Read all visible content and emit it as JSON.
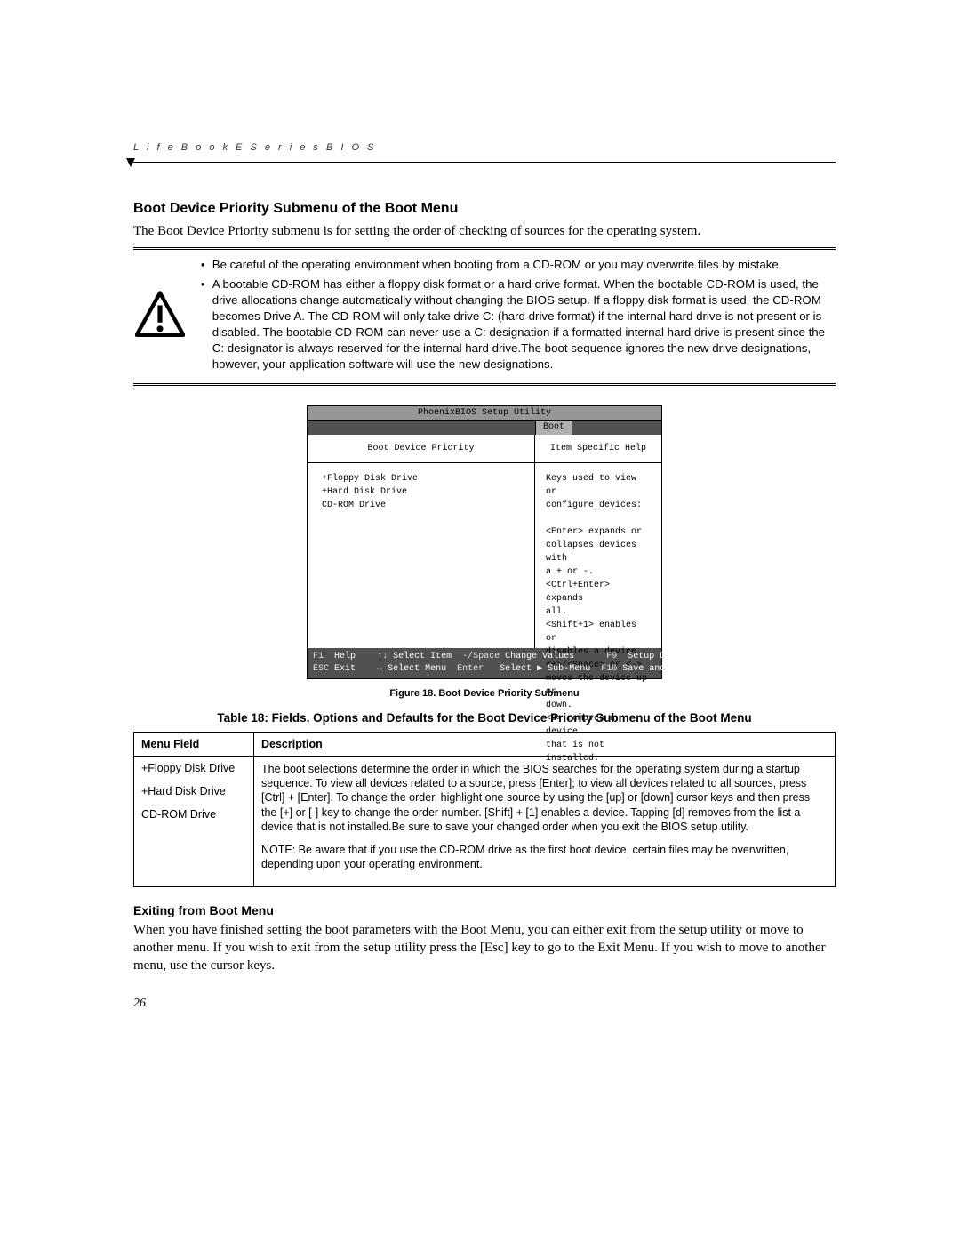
{
  "header": {
    "running_head": "L i f e B o o k   E   S e r i e s   B I O S"
  },
  "section": {
    "title": "Boot Device Priority Submenu of the Boot Menu",
    "intro": "The Boot Device Priority submenu is for setting the order of checking of sources for the operating system."
  },
  "caution": {
    "bullet1": "Be careful of the operating environment when booting from a CD-ROM or you may overwrite files by mistake.",
    "bullet2": "A bootable CD-ROM has either a floppy disk format or a hard drive format. When the bootable CD-ROM is used, the drive allocations change automatically without changing the BIOS setup. If a floppy disk format is used, the CD-ROM becomes Drive A. The CD-ROM will only take drive C: (hard drive format) if the internal hard drive is not present or is disabled. The bootable CD-ROM can never use a C: designation if a formatted internal hard drive is present since the C: designator is always reserved for the internal hard drive.The boot sequence ignores the new drive designations, however, your application software will use the new designations."
  },
  "bios": {
    "title": "PhoenixBIOS Setup Utility",
    "tab": "Boot",
    "left_head": "Boot Device Priority",
    "right_head": "Item Specific Help",
    "devices": [
      "+Floppy Disk Drive",
      "+Hard Disk Drive",
      " CD-ROM Drive"
    ],
    "help_lines": [
      "Keys used to view or",
      "configure devices:",
      "",
      "<Enter> expands or",
      "collapses devices with",
      "a + or -.",
      "<Ctrl+Enter> expands",
      "all.",
      "<Shift+1> enables or",
      "disables a device.",
      "<+>/<Space> or <->",
      "moves the device up or",
      "down.",
      "<d> removes a device",
      "that is not installed."
    ],
    "footer": {
      "row1": {
        "k1": "F1",
        "t1": "Help",
        "k2": "↑↓",
        "t2": "Select Item",
        "k3": "-/Space",
        "t3": "Change Values",
        "k4": "F9",
        "t4": "Setup Defaults"
      },
      "row2": {
        "k1": "ESC",
        "t1": "Exit",
        "k2": "↔",
        "t2": "Select Menu",
        "k3": "Enter",
        "t3": "Select ▶ Sub-Menu",
        "k4": "F10",
        "t4": "Save and Exit"
      }
    }
  },
  "figure_caption": "Figure 18.  Boot Device Priority Submenu",
  "table_title": "Table 18: Fields, Options and Defaults for the Boot Device Priority Submenu of the Boot Menu",
  "table": {
    "head1": "Menu Field",
    "head2": "Description",
    "menu_items": [
      "+Floppy Disk Drive",
      "+Hard Disk Drive",
      " CD-ROM Drive"
    ],
    "desc_p1": "The boot selections determine the order in which the BIOS searches for the operating system during a startup sequence. To view all devices related to a source, press [Enter]; to view all devices related to all sources, press [Ctrl] + [Enter]. To change the order, highlight one source by using the [up] or [down] cursor keys and then press the [+] or [-] key to change the order number. [Shift] + [1] enables a device. Tapping [d] removes from the list a device that is not installed.Be sure to save your changed order when you exit the BIOS setup utility.",
    "desc_p2": "NOTE: Be aware that if you use the CD-ROM drive as the first boot device, certain files may be overwritten, depending upon your operating environment."
  },
  "exit": {
    "title": "Exiting from Boot Menu",
    "body": "When you have finished setting the boot parameters with the Boot Menu, you can either exit from the setup utility or move to another menu. If you wish to exit from the setup utility press the [Esc] key to go to the Exit Menu. If you wish to move to another menu, use the cursor keys."
  },
  "page_number": "26"
}
